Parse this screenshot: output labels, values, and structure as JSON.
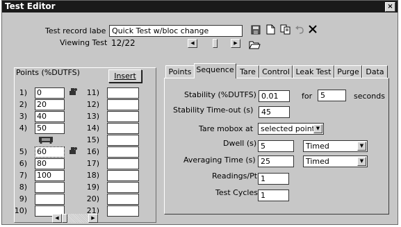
{
  "window": {
    "title": "Test Editor",
    "close_glyph": "×"
  },
  "header": {
    "record_label": "Test record labe",
    "record_value": "Quick Test w/bloc change",
    "viewing_label": "Viewing Test",
    "viewing_value": "12/22"
  },
  "toolbar": {
    "save_icon": "save-icon",
    "new_icon": "new-document-icon",
    "copy_icon": "copy-icon",
    "undo_icon": "undo-icon",
    "delete_icon": "delete-icon",
    "open_icon": "open-folder-icon"
  },
  "points": {
    "title": "Points (%DUTFS)",
    "insert_label": "Insert",
    "col1": [
      {
        "num": "1)",
        "value": "0"
      },
      {
        "num": "2)",
        "value": "20"
      },
      {
        "num": "3)",
        "value": "40"
      },
      {
        "num": "4)",
        "value": "50"
      },
      {
        "num": "5)",
        "value": "60"
      },
      {
        "num": "6)",
        "value": "80"
      },
      {
        "num": "7)",
        "value": "100"
      },
      {
        "num": "8)",
        "value": ""
      },
      {
        "num": "9)",
        "value": ""
      },
      {
        "num": "10)",
        "value": ""
      }
    ],
    "col2": [
      {
        "num": "11)",
        "value": ""
      },
      {
        "num": "12)",
        "value": ""
      },
      {
        "num": "13)",
        "value": ""
      },
      {
        "num": "14)",
        "value": ""
      },
      {
        "num": "15)",
        "value": ""
      },
      {
        "num": "16)",
        "value": ""
      },
      {
        "num": "17)",
        "value": ""
      },
      {
        "num": "18)",
        "value": ""
      },
      {
        "num": "19)",
        "value": ""
      },
      {
        "num": "20)",
        "value": ""
      },
      {
        "num": "21)",
        "value": ""
      }
    ]
  },
  "tabs": [
    {
      "label": "Points"
    },
    {
      "label": "Sequence"
    },
    {
      "label": "Tare"
    },
    {
      "label": "Control"
    },
    {
      "label": "Leak Test"
    },
    {
      "label": "Purge"
    },
    {
      "label": "Data"
    }
  ],
  "sequence": {
    "stability_label": "Stability (%DUTFS)",
    "stability_value": "0.01",
    "for_label": "for",
    "for_value": "5",
    "seconds_label": "seconds",
    "timeout_label": "Stability Time-out (s)",
    "timeout_value": "45",
    "tare_label": "Tare mobox at",
    "tare_value": "selected points",
    "dwell_label": "Dwell (s)",
    "dwell_value": "5",
    "dwell_mode": "Timed",
    "avg_label": "Averaging Time (s)",
    "avg_value": "25",
    "avg_mode": "Timed",
    "readings_label": "Readings/Pt",
    "readings_value": "1",
    "cycles_label": "Test Cycles",
    "cycles_value": "1"
  }
}
